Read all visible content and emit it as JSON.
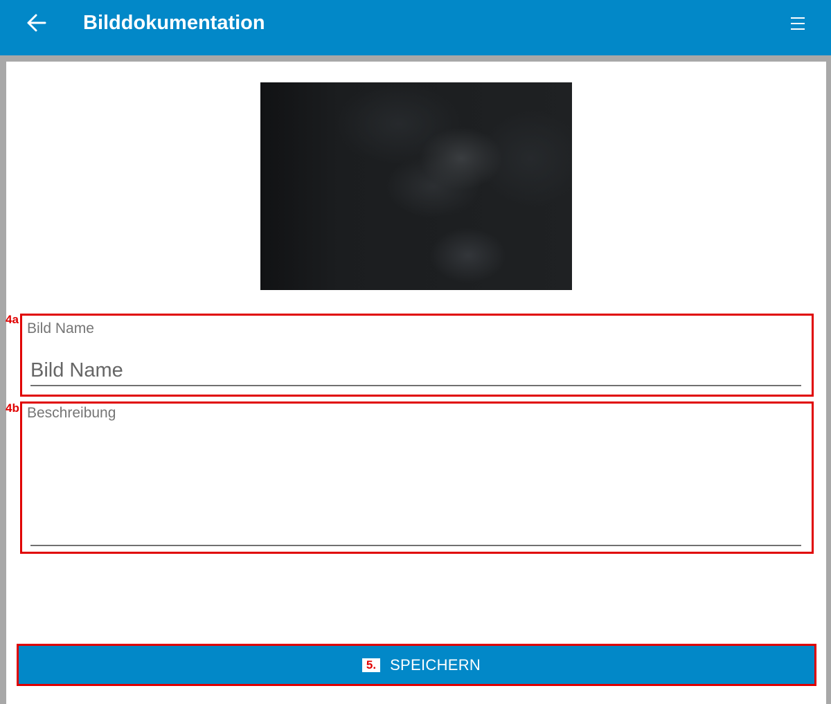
{
  "appbar": {
    "title": "Bilddokumentation",
    "back_icon": "arrow-left-icon",
    "menu_icon": "hamburger-menu-icon"
  },
  "form": {
    "image_name": {
      "label": "Bild Name",
      "placeholder": "Bild Name",
      "value": ""
    },
    "description": {
      "label": "Beschreibung",
      "placeholder": "",
      "value": ""
    }
  },
  "annotations": {
    "name_field": "4a",
    "description_field": "4b",
    "save_button": "5."
  },
  "save_button": {
    "label": "SPEICHERN"
  },
  "colors": {
    "primary": "#0288c8",
    "annotation": "#e00000",
    "background": "#a8a8a8"
  }
}
